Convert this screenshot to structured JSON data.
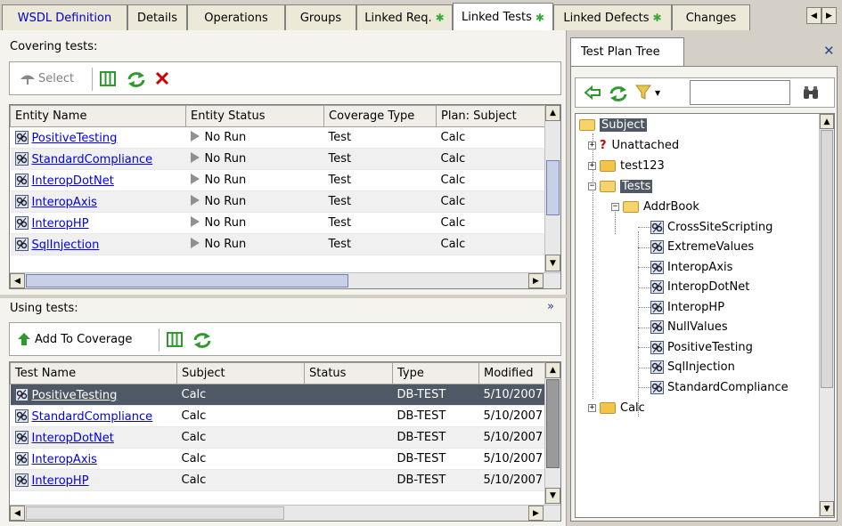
{
  "tabs": [
    {
      "label": "WSDL Definition",
      "active": false,
      "star": false
    },
    {
      "label": "Details",
      "active": false,
      "star": false
    },
    {
      "label": "Operations",
      "active": false,
      "star": false
    },
    {
      "label": "Groups",
      "active": false,
      "star": false
    },
    {
      "label": "Linked Req.",
      "active": false,
      "star": true
    },
    {
      "label": "Linked Tests",
      "active": true,
      "star": true
    },
    {
      "label": "Linked Defects",
      "active": false,
      "star": true
    },
    {
      "label": "Changes",
      "active": false,
      "star": false
    }
  ],
  "covering": {
    "title": "Covering tests:",
    "select_label": "Select",
    "columns": [
      "Entity Name",
      "Entity Status",
      "Coverage Type",
      "Plan: Subject"
    ],
    "rows": [
      {
        "name": "PositiveTesting",
        "status": "No Run",
        "type": "Test",
        "subject": "Calc"
      },
      {
        "name": "StandardCompliance",
        "status": "No Run",
        "type": "Test",
        "subject": "Calc"
      },
      {
        "name": "InteropDotNet",
        "status": "No Run",
        "type": "Test",
        "subject": "Calc"
      },
      {
        "name": "InteropAxis",
        "status": "No Run",
        "type": "Test",
        "subject": "Calc"
      },
      {
        "name": "InteropHP",
        "status": "No Run",
        "type": "Test",
        "subject": "Calc"
      },
      {
        "name": "SqlInjection",
        "status": "No Run",
        "type": "Test",
        "subject": "Calc"
      }
    ]
  },
  "using": {
    "title": "Using tests:",
    "add_label": "Add To Coverage",
    "columns": [
      "Test Name",
      "Subject",
      "Status",
      "Type",
      "Modified"
    ],
    "rows": [
      {
        "name": "PositiveTesting",
        "subject": "Calc",
        "status": "",
        "type": "DB-TEST",
        "modified": "5/10/2007",
        "selected": true
      },
      {
        "name": "StandardCompliance",
        "subject": "Calc",
        "status": "",
        "type": "DB-TEST",
        "modified": "5/10/2007",
        "selected": false
      },
      {
        "name": "InteropDotNet",
        "subject": "Calc",
        "status": "",
        "type": "DB-TEST",
        "modified": "5/10/2007",
        "selected": false
      },
      {
        "name": "InteropAxis",
        "subject": "Calc",
        "status": "",
        "type": "DB-TEST",
        "modified": "5/10/2007",
        "selected": false
      },
      {
        "name": "InteropHP",
        "subject": "Calc",
        "status": "",
        "type": "DB-TEST",
        "modified": "5/10/2007",
        "selected": false
      }
    ]
  },
  "tree": {
    "title": "Test Plan Tree",
    "search_value": "",
    "root": "Subject",
    "unattached": "Unattached",
    "test123": "test123",
    "tests": "Tests",
    "addrbook": "AddrBook",
    "leaves": [
      "CrossSiteScripting",
      "ExtremeValues",
      "InteropAxis",
      "InteropDotNet",
      "InteropHP",
      "NullValues",
      "PositiveTesting",
      "SqlInjection",
      "StandardCompliance"
    ],
    "calc": "Calc"
  },
  "colors": {
    "accent_blue": "#0000ee",
    "selected_row": "#4e5965",
    "green_icon": "#2e9a2e",
    "red_x": "#cc0000"
  }
}
